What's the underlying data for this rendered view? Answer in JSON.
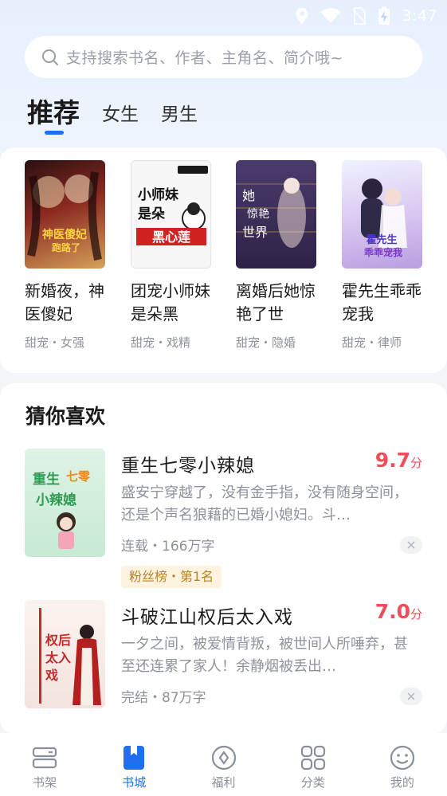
{
  "status_bar": {
    "time": "3:47"
  },
  "search": {
    "placeholder": "支持搜索书名、作者、主角名、简介哦~"
  },
  "tabs": [
    {
      "label": "推荐",
      "active": true
    },
    {
      "label": "女生",
      "active": false
    },
    {
      "label": "男生",
      "active": false
    }
  ],
  "recommend": {
    "books": [
      {
        "title": "新婚夜，神医傻妃",
        "tags": "甜宠・女强",
        "cover_text": "神医傻妃跑路了",
        "cover_color": "#7a1f1f"
      },
      {
        "title": "团宠小师妹是朵黑",
        "tags": "甜宠・戏精",
        "cover_text": "小师妹是朵黑心莲",
        "cover_color": "#f4f4f4"
      },
      {
        "title": "离婚后她惊艳了世",
        "tags": "甜宠・隐婚",
        "cover_text": "她惊艳了世界",
        "cover_color": "#3d2f5c"
      },
      {
        "title": "霍先生乖乖宠我",
        "tags": "甜宠・律师",
        "cover_text": "霍先生乖乖宠我",
        "cover_color": "#c9b6e8"
      }
    ]
  },
  "guess": {
    "heading": "猜你喜欢",
    "books": [
      {
        "title": "重生七零小辣媳",
        "score": "9.7",
        "score_unit": "分",
        "desc": "盛安宁穿越了，没有金手指，没有随身空间，还是个声名狼藉的已婚小媳妇。斗…",
        "meta": "连载・166万字",
        "badge": "粉丝榜・第1名",
        "cover_text": "重生七零小辣媳"
      },
      {
        "title": "斗破江山权后太入戏",
        "score": "7.0",
        "score_unit": "分",
        "desc": "一夕之间，被爱情背叛，被世间人所唾弃，甚至还连累了家人！余静烟被丢出…",
        "meta": "完结・87万字",
        "cover_text": "权后太入戏"
      }
    ]
  },
  "bottom_nav": [
    {
      "label": "书架",
      "icon": "bookshelf-icon",
      "active": false
    },
    {
      "label": "书城",
      "icon": "bookstore-icon",
      "active": true
    },
    {
      "label": "福利",
      "icon": "welfare-icon",
      "active": false
    },
    {
      "label": "分类",
      "icon": "category-icon",
      "active": false
    },
    {
      "label": "我的",
      "icon": "profile-icon",
      "active": false
    }
  ],
  "colors": {
    "accent": "#1f6ff0",
    "score": "#f04d5a"
  }
}
